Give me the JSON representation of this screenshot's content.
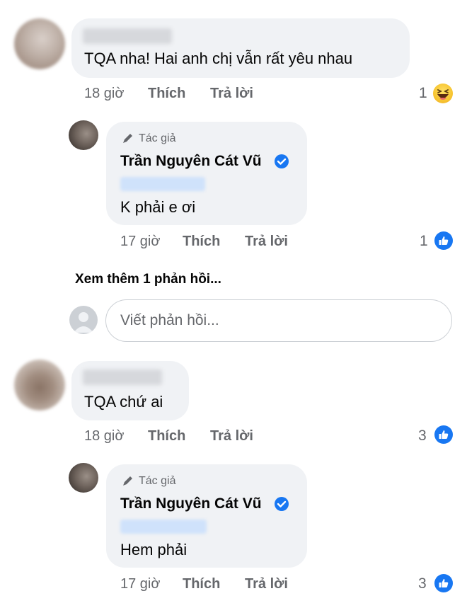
{
  "thread": {
    "comments": [
      {
        "text": "TQA nha! Hai anh chị vẫn rất yêu nhau",
        "time": "18 giờ",
        "like_label": "Thích",
        "reply_label": "Trả lời",
        "reaction_count": "1",
        "reaction_icon": "haha-icon",
        "reply": {
          "author_tag": "Tác giả",
          "author_name": "Trần Nguyên Cát Vũ",
          "text": "K phải e ơi",
          "time": "17 giờ",
          "like_label": "Thích",
          "reply_label": "Trả lời",
          "reaction_count": "1",
          "reaction_icon": "like-icon"
        }
      },
      {
        "text": "TQA chứ ai",
        "time": "18 giờ",
        "like_label": "Thích",
        "reply_label": "Trả lời",
        "reaction_count": "3",
        "reaction_icon": "like-icon",
        "reply": {
          "author_tag": "Tác giả",
          "author_name": "Trần Nguyên Cát Vũ",
          "text": "Hem phải",
          "time": "17 giờ",
          "like_label": "Thích",
          "reply_label": "Trả lời",
          "reaction_count": "3",
          "reaction_icon": "like-icon"
        }
      }
    ],
    "more_replies_label": "Xem thêm 1 phản hồi...",
    "reply_input_placeholder": "Viết phản hồi..."
  },
  "colors": {
    "bubble_bg": "#f0f2f5",
    "meta_text": "#65676b",
    "like_blue": "#1877f2",
    "verified_blue": "#1877f2"
  }
}
